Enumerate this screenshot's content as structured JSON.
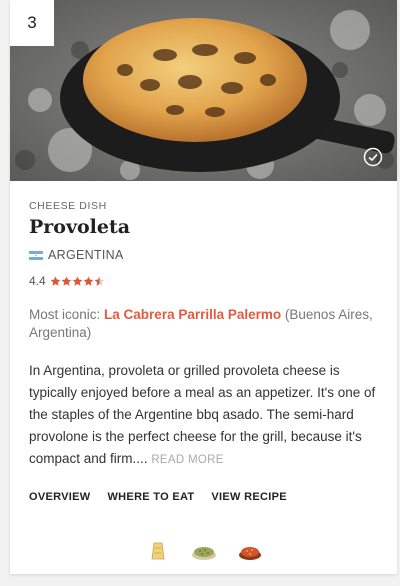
{
  "card": {
    "rank": "3",
    "category": "CHEESE DISH",
    "title": "Provoleta",
    "country": "ARGENTINA",
    "rating": "4.4",
    "rating_value": 4.4,
    "rating_max": 5,
    "iconic_label": "Most iconic:",
    "iconic_place": "La Cabrera Parrilla Palermo",
    "iconic_location": "(Buenos Aires, Argentina)",
    "description": "In Argentina, provoleta or grilled provoleta cheese is typically enjoyed before a meal as an appetizer. It's one of the staples of the Argentine bbq asado. The semi-hard provolone is the perfect cheese for the grill, because it's compact and firm....",
    "read_more": "READ MORE",
    "tabs": [
      {
        "label": "OVERVIEW"
      },
      {
        "label": "WHERE TO EAT"
      },
      {
        "label": "VIEW RECIPE"
      }
    ],
    "ingredient_icons": [
      "cheese-icon",
      "oregano-icon",
      "chili-flakes-icon"
    ]
  },
  "colors": {
    "accent": "#e35b3f",
    "star": "#e0553a",
    "flag_blue": "#74acdf"
  }
}
